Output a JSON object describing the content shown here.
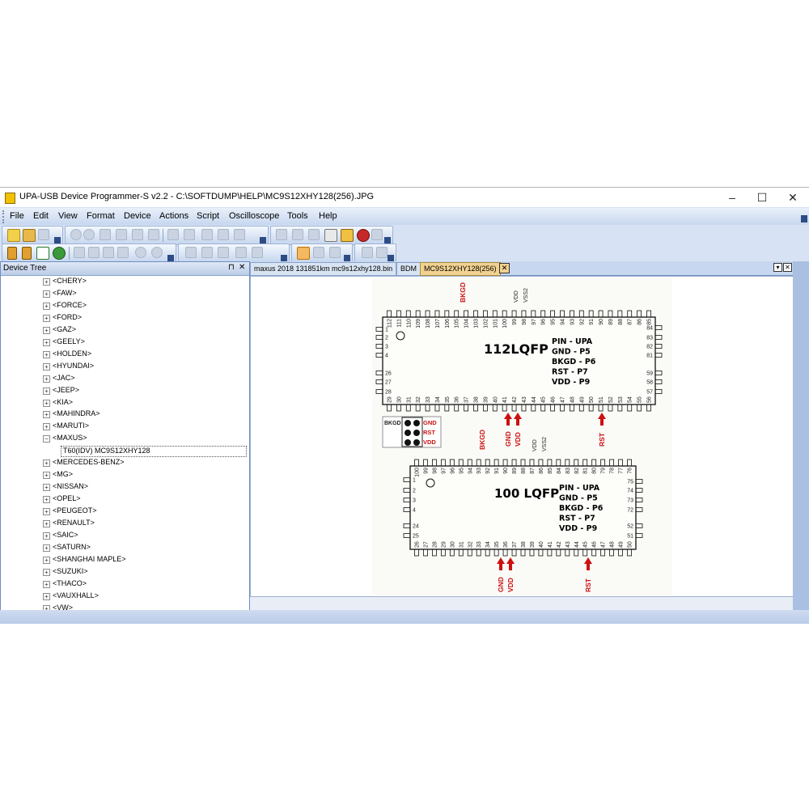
{
  "window": {
    "title": "UPA-USB Device Programmer-S v2.2 - C:\\SOFTDUMP\\HELP\\MC9S12XHY128(256).JPG",
    "minimize": "–",
    "maximize": "☐",
    "close": "✕"
  },
  "menu": [
    "File",
    "Edit",
    "View",
    "Format",
    "Device",
    "Actions",
    "Script",
    "Oscilloscope",
    "Tools",
    "Help"
  ],
  "device_tree": {
    "title": "Device Tree",
    "pin_glyph": "⊓",
    "close_glyph": "✕",
    "items": [
      {
        "label": "<CHERY>",
        "state": "+"
      },
      {
        "label": "<FAW>",
        "state": "+"
      },
      {
        "label": "<FORCE>",
        "state": "+"
      },
      {
        "label": "<FORD>",
        "state": "+"
      },
      {
        "label": "<GAZ>",
        "state": "+"
      },
      {
        "label": "<GEELY>",
        "state": "+"
      },
      {
        "label": "<HOLDEN>",
        "state": "+"
      },
      {
        "label": "<HYUNDAI>",
        "state": "+"
      },
      {
        "label": "<JAC>",
        "state": "+"
      },
      {
        "label": "<JEEP>",
        "state": "+"
      },
      {
        "label": "<KIA>",
        "state": "+"
      },
      {
        "label": "<MAHINDRA>",
        "state": "+"
      },
      {
        "label": "<MARUTI>",
        "state": "+"
      },
      {
        "label": "<MAXUS>",
        "state": "−"
      },
      {
        "label": "T60(IDV) MC9S12XHY128",
        "state": "leaf"
      },
      {
        "label": "<MERCEDES-BENZ>",
        "state": "+"
      },
      {
        "label": "<MG>",
        "state": "+"
      },
      {
        "label": "<NISSAN>",
        "state": "+"
      },
      {
        "label": "<OPEL>",
        "state": "+"
      },
      {
        "label": "<PEUGEOT>",
        "state": "+"
      },
      {
        "label": "<RENAULT>",
        "state": "+"
      },
      {
        "label": "<SAIC>",
        "state": "+"
      },
      {
        "label": "<SATURN>",
        "state": "+"
      },
      {
        "label": "<SHANGHAI MAPLE>",
        "state": "+"
      },
      {
        "label": "<SUZUKI>",
        "state": "+"
      },
      {
        "label": "<THACO>",
        "state": "+"
      },
      {
        "label": "<VAUXHALL>",
        "state": "+"
      },
      {
        "label": "<VW>",
        "state": "+"
      }
    ]
  },
  "tabs": [
    {
      "label": "maxus 2018 131851km mc9s12xhy128.bin",
      "active": false
    },
    {
      "label": "BDM",
      "active": false
    },
    {
      "label": "MC9S12XHY128(256)",
      "active": true
    }
  ],
  "tab_close": "✕",
  "diagram": {
    "chip1": {
      "name": "112LQFP",
      "legend": [
        "PIN  -  UPA",
        "GND  -  P5",
        "BKGD - P6",
        "RST   -  P7",
        "VDD   -  P9"
      ],
      "top_pins": [
        "112",
        "111",
        "110",
        "109",
        "108",
        "107",
        "106",
        "105",
        "104",
        "103",
        "102",
        "101",
        "100",
        "99",
        "98",
        "97",
        "96",
        "95",
        "94",
        "93",
        "92",
        "91",
        "90",
        "89",
        "88",
        "87",
        "86",
        "85"
      ],
      "bottom_pins": [
        "29",
        "30",
        "31",
        "32",
        "33",
        "34",
        "35",
        "36",
        "37",
        "38",
        "39",
        "40",
        "41",
        "42",
        "43",
        "44",
        "45",
        "46",
        "47",
        "48",
        "49",
        "50",
        "51",
        "52",
        "53",
        "54",
        "55",
        "56"
      ],
      "left_pins": [
        "1",
        "2",
        "3",
        "4",
        "26",
        "27",
        "28"
      ],
      "right_pins": [
        "84",
        "83",
        "82",
        "81",
        "59",
        "58",
        "57"
      ],
      "top_labels": [
        "BKGD",
        "VDD",
        "VSS2"
      ],
      "bottom_labels": [
        "GND",
        "VDD",
        "RST"
      ]
    },
    "connector": {
      "left": "BKGD",
      "right": [
        "GND",
        "RST",
        "VDD"
      ]
    },
    "chip2": {
      "name": "100 LQFP",
      "legend": [
        "PIN    -  UPA",
        "GND  -  P5",
        "BKGD - P6",
        "RST   -  P7",
        "VDD   -  P9"
      ],
      "top_pins": [
        "100",
        "99",
        "98",
        "97",
        "96",
        "95",
        "94",
        "93",
        "92",
        "91",
        "90",
        "89",
        "88",
        "87",
        "86",
        "85",
        "84",
        "83",
        "82",
        "81",
        "80",
        "79",
        "78",
        "77",
        "76"
      ],
      "bottom_pins": [
        "26",
        "27",
        "28",
        "29",
        "30",
        "31",
        "32",
        "33",
        "34",
        "35",
        "36",
        "37",
        "38",
        "39",
        "40",
        "41",
        "42",
        "43",
        "44",
        "45",
        "46",
        "47",
        "48",
        "49",
        "50"
      ],
      "left_pins": [
        "1",
        "2",
        "3",
        "4",
        "24",
        "25"
      ],
      "right_pins": [
        "75",
        "74",
        "73",
        "72",
        "52",
        "51"
      ],
      "top_labels": [
        "BKGD",
        "VDD",
        "VSS2"
      ],
      "bottom_labels": [
        "GND",
        "VDD",
        "RST"
      ]
    }
  },
  "colors": {
    "accent_red": "#cc1111",
    "menubar": "#c7d7ef",
    "active_tab": "#f2d290"
  }
}
